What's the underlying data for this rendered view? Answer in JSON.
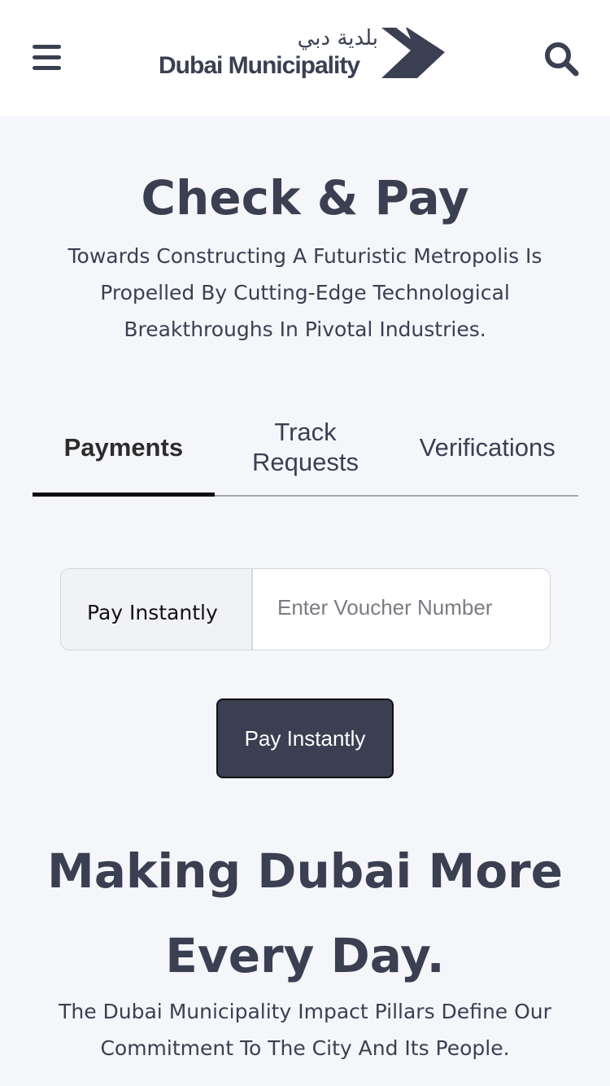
{
  "header": {
    "logo_arabic": "بلدية دبي",
    "logo_english": "Dubai Municipality",
    "menu_icon": "hamburger-menu-icon",
    "search_icon": "search-icon",
    "brand_color": "#3b3f52"
  },
  "hero": {
    "title": "Check & Pay",
    "subtitle": "Towards Constructing A Futuristic Metropolis Is Propelled By Cutting-Edge Technological Breakthroughs In Pivotal Industries."
  },
  "tabs": [
    {
      "label": "Payments",
      "active": true
    },
    {
      "label": "Track Requests",
      "active": false
    },
    {
      "label": "Verifications",
      "active": false
    }
  ],
  "voucher": {
    "label": "Pay Instantly",
    "placeholder": "Enter Voucher Number",
    "value": ""
  },
  "pay_button": {
    "label": "Pay Instantly"
  },
  "section": {
    "title": "Making Dubai More Every Day.",
    "subtitle": "The Dubai Municipality Impact Pillars Define Our Commitment To The City And Its People."
  }
}
